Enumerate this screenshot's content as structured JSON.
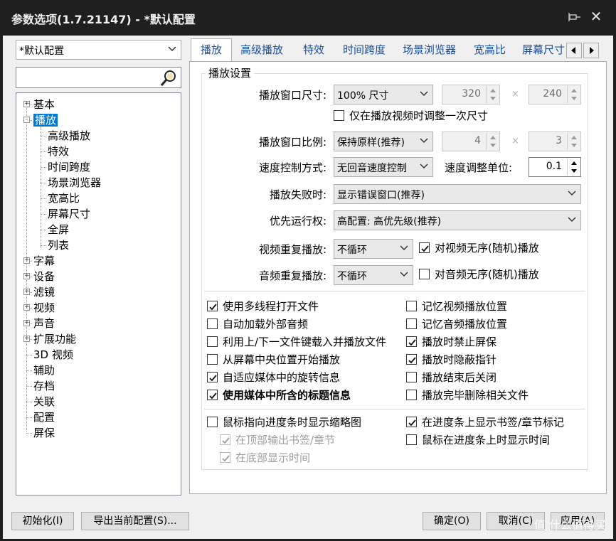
{
  "window": {
    "title": "参数选项(1.7.21147) - *默认配置"
  },
  "left": {
    "profile_value": "*默认配置",
    "search_value": "",
    "tree": [
      {
        "label": "基本",
        "expander": "+"
      },
      {
        "label": "播放",
        "expander": "-",
        "selected": true
      },
      {
        "label": "高级播放"
      },
      {
        "label": "特效"
      },
      {
        "label": "时间跨度"
      },
      {
        "label": "场景浏览器"
      },
      {
        "label": "宽高比"
      },
      {
        "label": "屏幕尺寸"
      },
      {
        "label": "全屏"
      },
      {
        "label": "列表"
      },
      {
        "label": "字幕",
        "expander": "+"
      },
      {
        "label": "设备",
        "expander": "+"
      },
      {
        "label": "滤镜",
        "expander": "+"
      },
      {
        "label": "视频",
        "expander": "+"
      },
      {
        "label": "声音",
        "expander": "+"
      },
      {
        "label": "扩展功能",
        "expander": "+"
      },
      {
        "label": "3D 视频"
      },
      {
        "label": "辅助"
      },
      {
        "label": "存档"
      },
      {
        "label": "关联"
      },
      {
        "label": "配置"
      },
      {
        "label": "屏保"
      }
    ]
  },
  "tabs": [
    "播放",
    "高级播放",
    "特效",
    "时间跨度",
    "场景浏览器",
    "宽高比",
    "屏幕尺寸"
  ],
  "playback": {
    "group_title": "播放设置",
    "window_size_label": "播放窗口尺寸:",
    "window_size_value": "100% 尺寸",
    "width": "320",
    "height": "240",
    "times": "×",
    "resize_once_label": "仅在播放视频时调整一次尺寸",
    "aspect_label": "播放窗口比例:",
    "aspect_value": "保持原样(推荐)",
    "aspect_w": "4",
    "aspect_h": "3",
    "speed_mode_label": "速度控制方式:",
    "speed_mode_value": "无回音速度控制",
    "speed_unit_label": "速度调整单位:",
    "speed_unit_value": "0.1",
    "fail_label": "播放失败时:",
    "fail_value": "显示错误窗口(推荐)",
    "priority_label": "优先运行权:",
    "priority_value": "高配置: 高优先级(推荐)",
    "video_repeat_label": "视频重复播放:",
    "video_repeat_value": "不循环",
    "video_shuffle_label": "对视频无序(随机)播放",
    "audio_repeat_label": "音频重复播放:",
    "audio_repeat_value": "不循环",
    "audio_shuffle_label": "对音频无序(随机)播放"
  },
  "checks_left": [
    {
      "label": "使用多线程打开文件",
      "checked": true
    },
    {
      "label": "自动加载外部音频",
      "checked": false
    },
    {
      "label": "利用上/下一文件键载入并播放文件",
      "checked": false
    },
    {
      "label": "从屏幕中央位置开始播放",
      "checked": false
    },
    {
      "label": "自适应媒体中的旋转信息",
      "checked": true
    },
    {
      "label": "使用媒体中所含的标题信息",
      "checked": true,
      "bold": true
    }
  ],
  "checks_right": [
    {
      "label": "记忆视频播放位置",
      "checked": false
    },
    {
      "label": "记忆音频播放位置",
      "checked": false
    },
    {
      "label": "播放时禁止屏保",
      "checked": true
    },
    {
      "label": "播放时隐蔽指针",
      "checked": true
    },
    {
      "label": "播放结束后关闭",
      "checked": false
    },
    {
      "label": "播放完毕删除相关文件",
      "checked": false
    }
  ],
  "seek": {
    "thumb_label": "鼠标指向进度条时显示缩略图",
    "top_bookmark_label": "在顶部输出书签/章节",
    "bottom_time_label": "在底部显示时间",
    "show_bookmarks_label": "在进度条上显示书签/章节标记",
    "hover_time_label": "鼠标在进度条上时显示时间"
  },
  "buttons": {
    "init": "初始化(I)",
    "export": "导出当前配置(S)...",
    "ok": "确定(O)",
    "cancel": "取消(C)",
    "apply": "应用(A)"
  },
  "watermark": "值 什么值得买"
}
